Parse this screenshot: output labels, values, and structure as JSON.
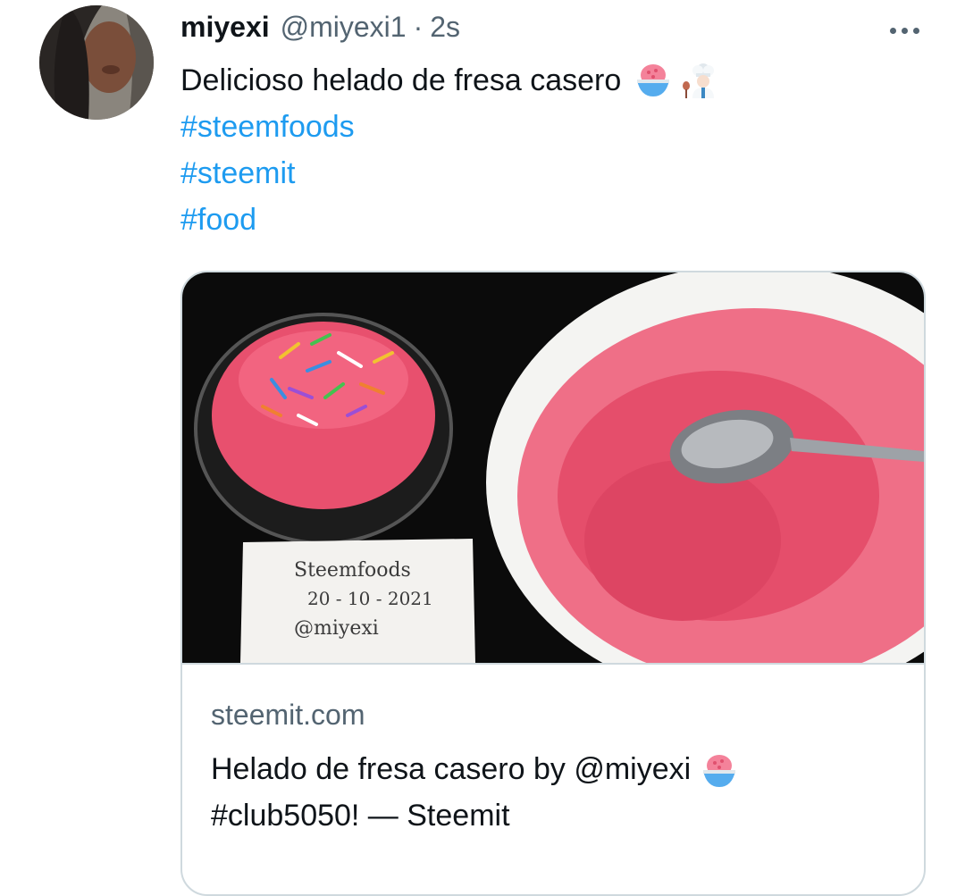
{
  "tweet": {
    "display_name": "miyexi",
    "handle": "@miyexi1",
    "separator": "·",
    "timestamp": "2s",
    "text": "Delicioso helado de fresa casero",
    "emojis": [
      "shaved-ice-emoji",
      "woman-cook-emoji"
    ],
    "hashtags": [
      "#steemfoods",
      "#steemit",
      "#food"
    ]
  },
  "link_card": {
    "domain": "steemit.com",
    "title_line1": "Helado de fresa casero by @miyexi",
    "title_line2": "#club5050! — Steemit",
    "image_note_lines": [
      "Steemfoods",
      "20 - 10 - 2021",
      "@miyexi"
    ]
  },
  "colors": {
    "link": "#1d9bf0",
    "secondary_text": "#536471",
    "primary_text": "#0f1419",
    "border": "#cfd9de"
  },
  "icons": {
    "more": "more-horizontal-icon"
  }
}
